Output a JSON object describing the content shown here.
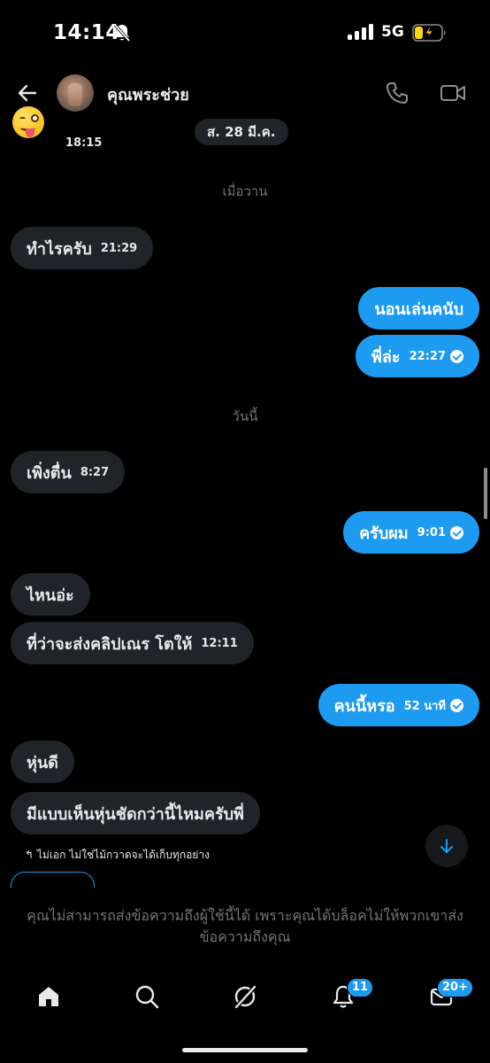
{
  "status_bar": {
    "time": "14:14",
    "network": "5G"
  },
  "header": {
    "contact_name": "คุณพระช่วย"
  },
  "chat": {
    "first_timestamp": "18:15",
    "date_pill": "ส. 28 มี.ค.",
    "divider_yesterday": "เมื่อวาน",
    "divider_today": "วันนี้",
    "messages": [
      {
        "text": "ทำไรครับ",
        "time": "21:29"
      },
      {
        "text": "นอนเล่นคนับ"
      },
      {
        "text": "พี่ล่ะ",
        "time": "22:27"
      },
      {
        "text": "เพิ่งตื่น",
        "time": "8:27"
      },
      {
        "text": "ครับผม",
        "time": "9:01"
      },
      {
        "text": "ไหนอ่ะ"
      },
      {
        "text": "ที่ว่าจะส่งคลิปเณร โตให้",
        "time": "12:11"
      },
      {
        "text": "คนนี้หรอ",
        "time": "52 นาที"
      },
      {
        "text": "หุ่นดี"
      },
      {
        "text": "มีแบบเห็นหุ่นชัดกว่านี้ไหมครับพี่"
      }
    ],
    "reply_note": "↰ ไม่เอก ไม่ใช่ไม้กวาดจะได้เก็บทุกอย่าง",
    "blocked_notice": "คุณไม่สามารถส่งข้อความถึงผู้ใช้นี้ได้ เพราะคุณได้บล็อคไม่ให้พวกเขาส่งข้อความถึงคุณ"
  },
  "tabbar": {
    "notifications_badge": "11",
    "messages_badge": "20+"
  },
  "colors": {
    "accent": "#1d9bf0",
    "incoming_bubble": "#202327",
    "muted_text": "#71767b",
    "background": "#000000"
  },
  "icons": [
    "bell-off-icon",
    "signal-icon",
    "battery-icon",
    "back-arrow-icon",
    "phone-icon",
    "video-icon",
    "arrow-down-icon",
    "home-icon",
    "search-icon",
    "grok-icon",
    "bell-icon",
    "mail-icon"
  ]
}
